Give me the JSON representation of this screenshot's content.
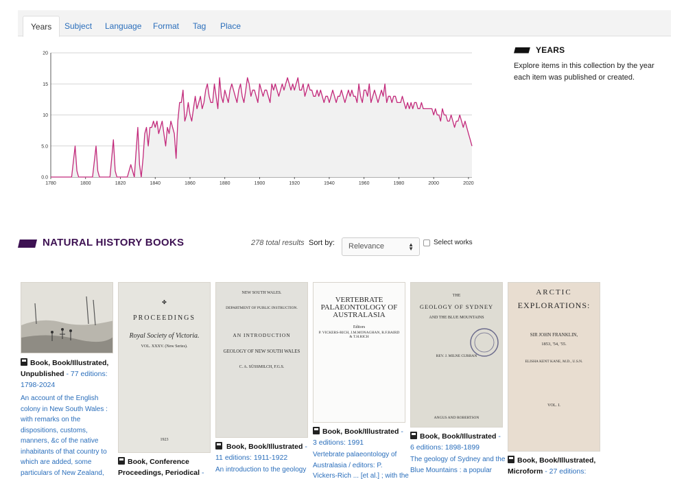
{
  "tabs": [
    "Years",
    "Subject",
    "Language",
    "Format",
    "Tag",
    "Place"
  ],
  "info": {
    "heading": "YEARS",
    "text": "Explore items in this collection by the year each item was published or created."
  },
  "colors": {
    "line": "#c2287a",
    "fill": "#f1f1f1",
    "accent": "#3d1152",
    "link": "#2a6ebb"
  },
  "chart_data": {
    "type": "area",
    "title": "",
    "xlabel": "",
    "ylabel": "",
    "xlim": [
      1780,
      2022
    ],
    "ylim": [
      0,
      20
    ],
    "x_ticks": [
      "1780",
      "1800",
      "1820",
      "1840",
      "1860",
      "1880",
      "1900",
      "1920",
      "1940",
      "1960",
      "1980",
      "2000",
      "2020"
    ],
    "y_ticks": [
      "0.0",
      "5.0",
      "10",
      "15",
      "20"
    ],
    "grid": true,
    "x": [
      1780,
      1792,
      1794,
      1795,
      1796,
      1798,
      1804,
      1806,
      1807,
      1808,
      1810,
      1814,
      1816,
      1817,
      1818,
      1820,
      1822,
      1824,
      1826,
      1827,
      1828,
      1829,
      1830,
      1831,
      1832,
      1833,
      1834,
      1835,
      1836,
      1837,
      1838,
      1839,
      1840,
      1841,
      1842,
      1843,
      1844,
      1845,
      1846,
      1847,
      1848,
      1849,
      1850,
      1851,
      1852,
      1853,
      1854,
      1855,
      1856,
      1857,
      1858,
      1859,
      1860,
      1861,
      1862,
      1863,
      1864,
      1865,
      1866,
      1867,
      1868,
      1869,
      1870,
      1871,
      1872,
      1873,
      1874,
      1875,
      1876,
      1877,
      1878,
      1879,
      1880,
      1881,
      1882,
      1883,
      1884,
      1885,
      1886,
      1887,
      1888,
      1889,
      1890,
      1891,
      1892,
      1893,
      1894,
      1895,
      1896,
      1897,
      1898,
      1899,
      1900,
      1901,
      1902,
      1903,
      1904,
      1905,
      1906,
      1907,
      1908,
      1909,
      1910,
      1911,
      1912,
      1913,
      1914,
      1915,
      1916,
      1917,
      1918,
      1919,
      1920,
      1921,
      1922,
      1923,
      1924,
      1925,
      1926,
      1927,
      1928,
      1929,
      1930,
      1931,
      1932,
      1933,
      1934,
      1935,
      1936,
      1937,
      1938,
      1939,
      1940,
      1941,
      1942,
      1943,
      1944,
      1945,
      1946,
      1947,
      1948,
      1949,
      1950,
      1951,
      1952,
      1953,
      1954,
      1955,
      1956,
      1957,
      1958,
      1959,
      1960,
      1961,
      1962,
      1963,
      1964,
      1965,
      1966,
      1967,
      1968,
      1969,
      1970,
      1971,
      1972,
      1973,
      1974,
      1975,
      1976,
      1977,
      1978,
      1979,
      1980,
      1981,
      1982,
      1983,
      1984,
      1985,
      1986,
      1987,
      1988,
      1989,
      1990,
      1991,
      1992,
      1993,
      1994,
      1995,
      1996,
      1997,
      1998,
      1999,
      2000,
      2001,
      2002,
      2003,
      2004,
      2005,
      2006,
      2007,
      2008,
      2009,
      2010,
      2011,
      2012,
      2013,
      2014,
      2015,
      2016,
      2017,
      2018,
      2019,
      2020,
      2021,
      2022
    ],
    "y": [
      0,
      0,
      5,
      1,
      0,
      0,
      0,
      5,
      1,
      0,
      0,
      0,
      6,
      1,
      0,
      0,
      0,
      0,
      2,
      1,
      0,
      4,
      8,
      2,
      0,
      3,
      7,
      8,
      5,
      8,
      8,
      9,
      8,
      9,
      7,
      8,
      9,
      7,
      5,
      8,
      7,
      9,
      8,
      7,
      3,
      9,
      12,
      12,
      14,
      9,
      10,
      12,
      10,
      9,
      11,
      13,
      11,
      12,
      13,
      11,
      12,
      14,
      15,
      13,
      12,
      12,
      15,
      13,
      11,
      16,
      13,
      12,
      14,
      13,
      12,
      14,
      15,
      14,
      13,
      12,
      14,
      15,
      13,
      12,
      14,
      16,
      15,
      13,
      14,
      14,
      13,
      12,
      15,
      14,
      13,
      14,
      14,
      13,
      12,
      15,
      14,
      15,
      14,
      13,
      14,
      15,
      14,
      15,
      16,
      15,
      14,
      15,
      14,
      15,
      16,
      14,
      14,
      15,
      13,
      14,
      15,
      14,
      14,
      13,
      13,
      14,
      13,
      14,
      13,
      12,
      13,
      13,
      12,
      13,
      14,
      13,
      12,
      13,
      13,
      14,
      13,
      12,
      13,
      14,
      13,
      14,
      13,
      13,
      12,
      15,
      13,
      12,
      14,
      14,
      13,
      15,
      12,
      13,
      14,
      13,
      12,
      13,
      14,
      13,
      15,
      12,
      13,
      13,
      12,
      13,
      13,
      12,
      12,
      12,
      13,
      12,
      11,
      12,
      11,
      12,
      11,
      12,
      12,
      11,
      11,
      12,
      11,
      11,
      11,
      11,
      11,
      11,
      10,
      11,
      10,
      10,
      9,
      11,
      10,
      10,
      9,
      9,
      10,
      9,
      8,
      9,
      9,
      10,
      9,
      8,
      9,
      8,
      7,
      6,
      5,
      5,
      4,
      4
    ]
  },
  "section": {
    "title": "NATURAL HISTORY BOOKS",
    "total": "278 total results",
    "sort_label": "Sort by:",
    "sort_value": "Relevance",
    "select_label": "Select works"
  },
  "books": [
    {
      "format": "Book, Book/Illustrated, Unpublished",
      "editions": "- 77 editions: 1798-2024",
      "title": "An account of the English colony in New South Wales : with remarks on the dispositions, customs, manners, &c of the native inhabitants of that country to which are added, some particulars of New Zealand,"
    },
    {
      "format": "Book, Conference Proceedings, Periodical",
      "editions": "-",
      "title": "",
      "cover": [
        "PROCEEDINGS",
        "Royal Society of Victoria.",
        "VOL. XXXV. (New Series).",
        "1923"
      ]
    },
    {
      "format": "Book, Book/Illustrated",
      "editions": "- 11 editions: 1911-1922",
      "title": "An introduction to the geology",
      "cover": [
        "NEW SOUTH WALES.",
        "DEPARTMENT OF PUBLIC INSTRUCTION.",
        "AN INTRODUCTION",
        "GEOLOGY OF NEW SOUTH WALES",
        "C. A. SÜSSMILCH, F.G.S."
      ]
    },
    {
      "format": "Book, Book/Illustrated",
      "editions": "- 3 editions: 1991",
      "title": "Vertebrate palaeontology of Australasia / editors: P. Vickers-Rich ... [et al.] ; with the",
      "cover": [
        "VERTEBRATE PALAEONTOLOGY OF AUSTRALASIA",
        "Editors",
        "P. VICKERS-RICH, J.M.MONAGHAN, R.F.BAIRD & T.H.RICH"
      ]
    },
    {
      "format": "Book, Book/Illustrated",
      "editions": "- 6 editions: 1898-1899",
      "title": "The geology of Sydney and the Blue Mountains : a popular",
      "cover": [
        "THE",
        "GEOLOGY OF SYDNEY",
        "AND THE BLUE MOUNTAINS",
        "REV. J. MILNE CURRAN",
        "ANGUS AND ROBERTSON"
      ]
    },
    {
      "format": "Book, Book/Illustrated, Microform",
      "editions": "- 27 editions:",
      "title": "",
      "cover": [
        "ARCTIC",
        "EXPLORATIONS:",
        "SIR JOHN FRANKLIN,",
        "1853, '54, '55.",
        "ELISHA KENT KANE, M.D., U.S.N.",
        "VOL. I."
      ]
    }
  ]
}
